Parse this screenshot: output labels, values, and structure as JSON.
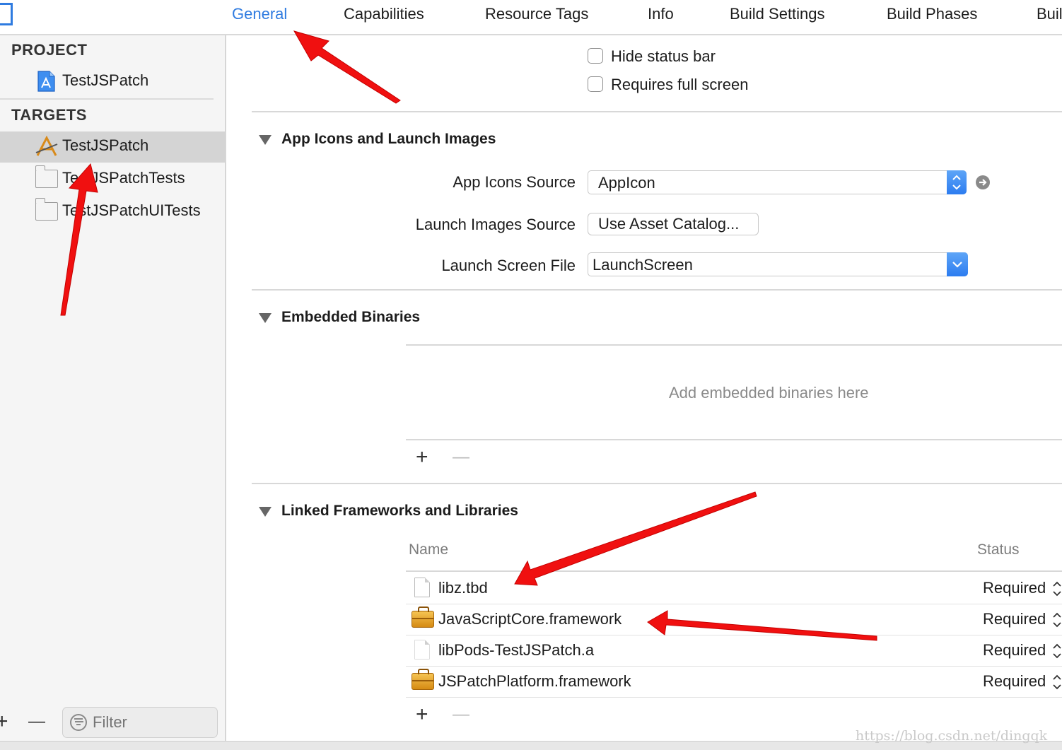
{
  "tabs": [
    {
      "label": "General",
      "active": true
    },
    {
      "label": "Capabilities"
    },
    {
      "label": "Resource Tags"
    },
    {
      "label": "Info"
    },
    {
      "label": "Build Settings"
    },
    {
      "label": "Build Phases"
    },
    {
      "label": "Buil"
    }
  ],
  "sidebar": {
    "project_header": "PROJECT",
    "project_item": "TestJSPatch",
    "targets_header": "TARGETS",
    "targets": [
      {
        "label": "TestJSPatch",
        "selected": true,
        "icon": "app-target-icon"
      },
      {
        "label": "TestJSPatchTests",
        "icon": "folder-icon"
      },
      {
        "label": "TestJSPatchUITests",
        "icon": "folder-icon"
      }
    ],
    "add_symbol": "+",
    "remove_symbol": "—",
    "filter_placeholder": "Filter"
  },
  "deployment": {
    "hide_status_bar": "Hide status bar",
    "requires_full_screen": "Requires full screen"
  },
  "app_icons": {
    "title": "App Icons and Launch Images",
    "app_icons_source_label": "App Icons Source",
    "app_icons_source_value": "AppIcon",
    "launch_images_source_label": "Launch Images Source",
    "launch_images_button": "Use Asset Catalog...",
    "launch_screen_file_label": "Launch Screen File",
    "launch_screen_file_value": "LaunchScreen"
  },
  "embedded": {
    "title": "Embedded Binaries",
    "placeholder": "Add embedded binaries here",
    "add_symbol": "+",
    "remove_symbol": "—"
  },
  "linked": {
    "title": "Linked Frameworks and Libraries",
    "col_name": "Name",
    "col_status": "Status",
    "rows": [
      {
        "name": "libz.tbd",
        "status": "Required",
        "icon": "file-icon"
      },
      {
        "name": "JavaScriptCore.framework",
        "status": "Required",
        "icon": "toolbox-icon"
      },
      {
        "name": "libPods-TestJSPatch.a",
        "status": "Required",
        "icon": "file-icon"
      },
      {
        "name": "JSPatchPlatform.framework",
        "status": "Required",
        "icon": "toolbox-icon"
      }
    ],
    "add_symbol": "+",
    "remove_symbol": "—"
  },
  "watermark": "https://blog.csdn.net/dingqk",
  "colors": {
    "accent": "#2f7be0",
    "annotation_arrow": "#f01010",
    "selection": "#d4d4d4"
  }
}
